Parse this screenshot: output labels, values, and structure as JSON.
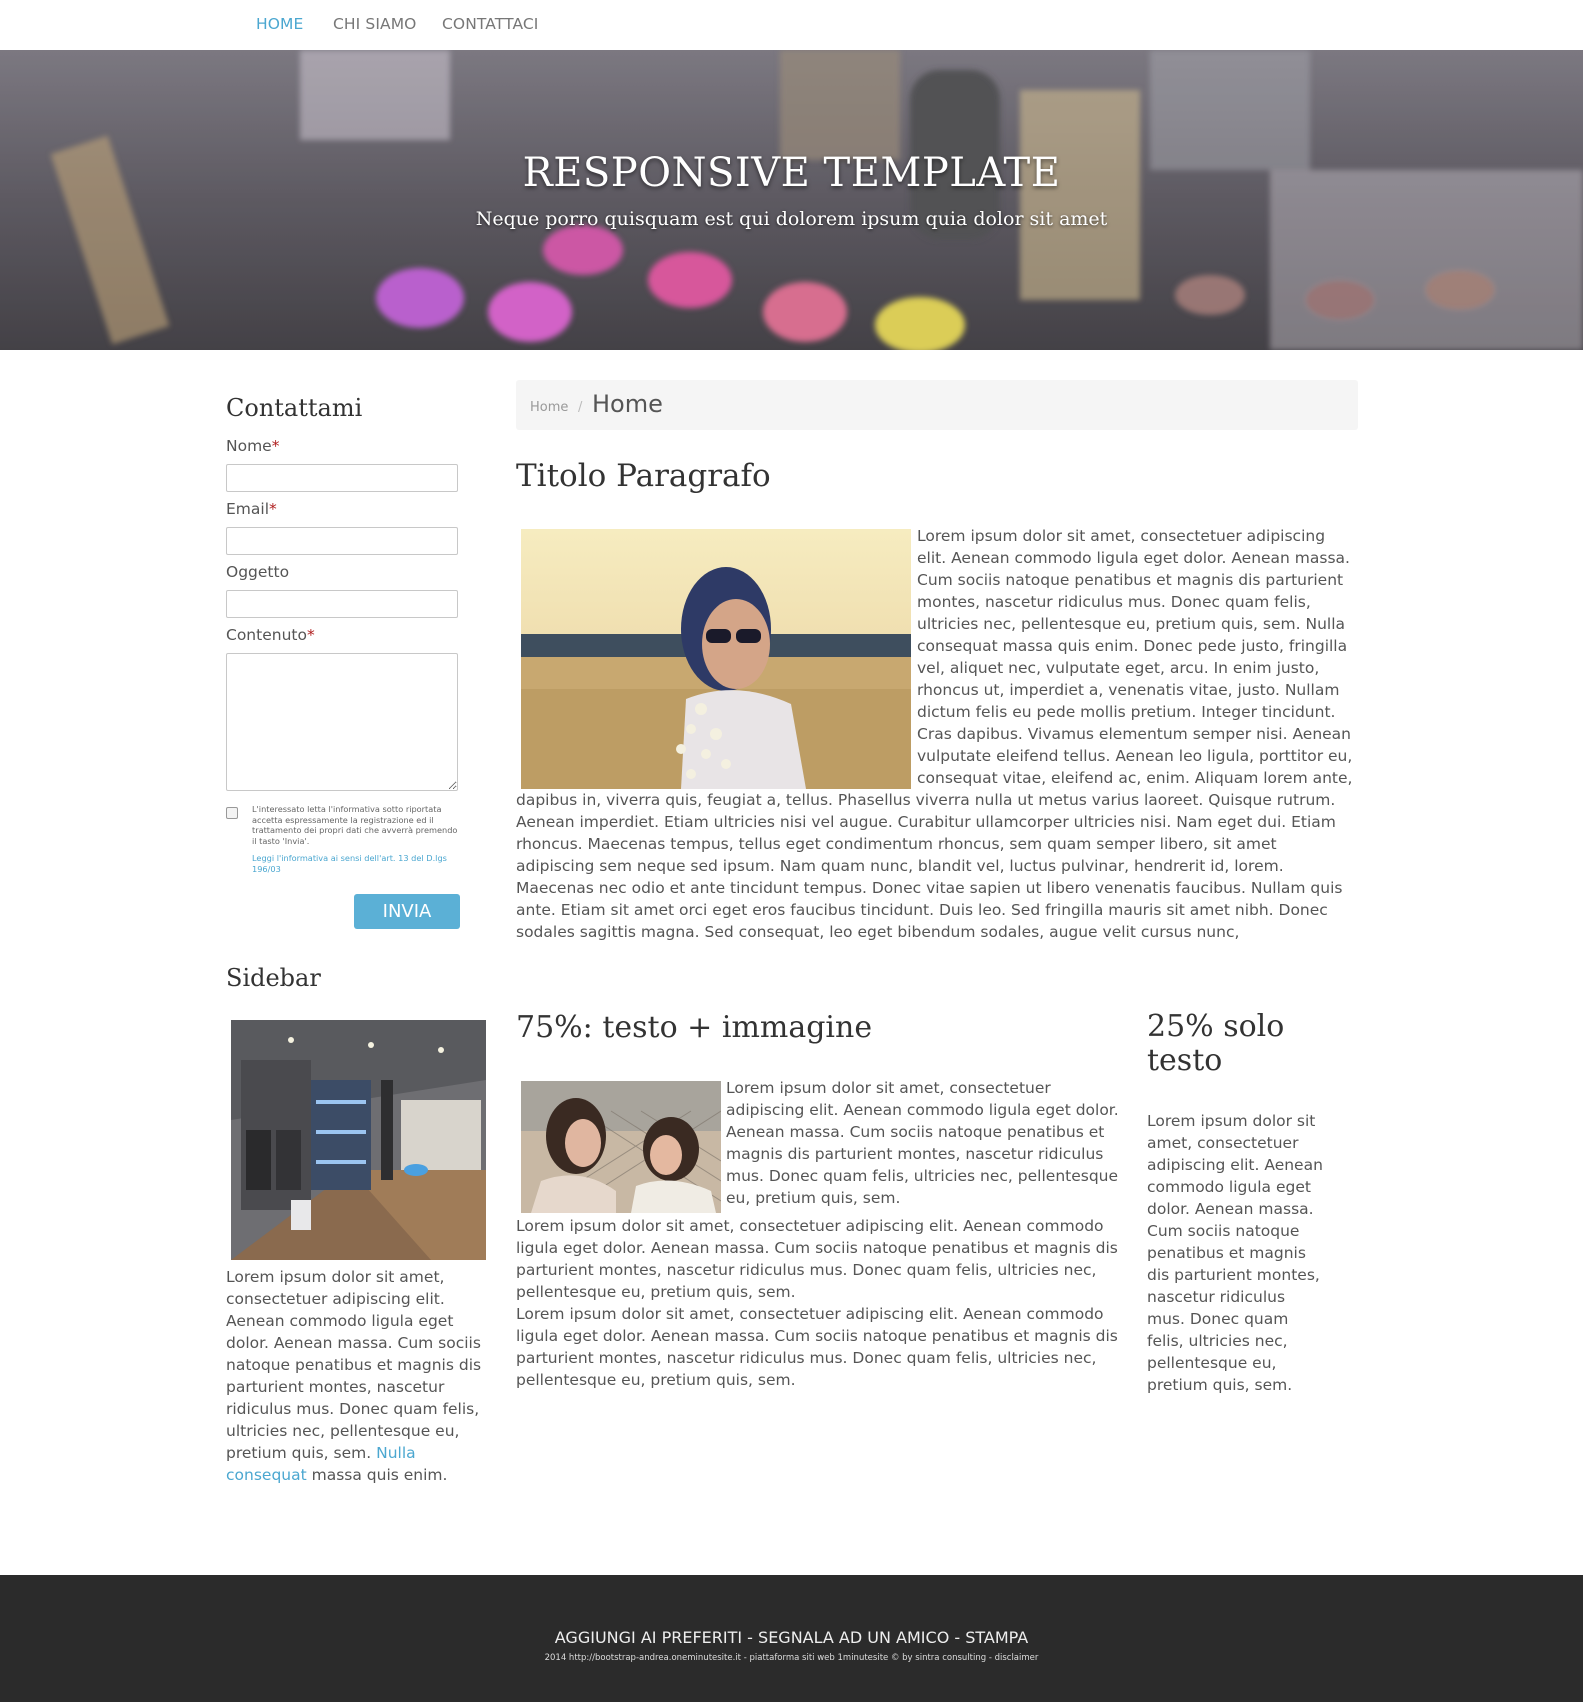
{
  "nav": {
    "items": [
      {
        "label": "HOME",
        "active": true
      },
      {
        "label": "CHI SIAMO",
        "active": false
      },
      {
        "label": "CONTATTACI",
        "active": false
      }
    ]
  },
  "hero": {
    "title": "RESPONSIVE TEMPLATE",
    "subtitle": "Neque porro quisquam est qui dolorem ipsum quia dolor sit amet"
  },
  "contact_form": {
    "heading": "Contattami",
    "fields": {
      "nome": {
        "label": "Nome",
        "required": "*",
        "value": ""
      },
      "email": {
        "label": "Email",
        "required": "*",
        "value": ""
      },
      "oggetto": {
        "label": "Oggetto",
        "value": ""
      },
      "contenuto": {
        "label": "Contenuto",
        "required": "*",
        "value": ""
      }
    },
    "consent_text": "L'interessato letta l'informativa sotto riportata accetta espressamente la registrazione ed il trattamento dei propri dati che avverrà premendo il tasto 'Invia'.",
    "consent_link": "Leggi l'informativa ai sensi dell'art. 13 del D.lgs 196/03",
    "submit_label": "INVIA"
  },
  "sidebar": {
    "heading": "Sidebar",
    "text_before_link": "Lorem ipsum dolor sit amet, consectetuer adipiscing elit. Aenean commodo ligula eget dolor. Aenean massa. Cum sociis natoque penatibus et magnis dis parturient montes, nascetur ridiculus mus. Donec quam felis, ultricies nec, pellentesque eu, pretium quis, sem.",
    "link_text": "Nulla consequat",
    "text_after_link": "massa quis enim."
  },
  "breadcrumb": {
    "home": "Home",
    "separator": "/",
    "current": "Home"
  },
  "main": {
    "heading": "Titolo Paragrafo",
    "body": "Lorem ipsum dolor sit amet, consectetuer adipiscing elit. Aenean commodo ligula eget dolor. Aenean massa. Cum sociis natoque penatibus et magnis dis parturient montes, nascetur ridiculus mus. Donec quam felis, ultricies nec, pellentesque eu, pretium quis, sem. Nulla consequat massa quis enim. Donec pede justo, fringilla vel, aliquet nec, vulputate eget, arcu. In enim justo, rhoncus ut, imperdiet a, venenatis vitae, justo. Nullam dictum felis eu pede mollis pretium. Integer tincidunt. Cras dapibus. Vivamus elementum semper nisi. Aenean vulputate eleifend tellus. Aenean leo ligula, porttitor eu, consequat vitae, eleifend ac, enim. Aliquam lorem ante, dapibus in, viverra quis, feugiat a, tellus. Phasellus viverra nulla ut metus varius laoreet. Quisque rutrum. Aenean imperdiet. Etiam ultricies nisi vel augue. Curabitur ullamcorper ultricies nisi. Nam eget dui. Etiam rhoncus. Maecenas tempus, tellus eget condimentum rhoncus, sem quam semper libero, sit amet adipiscing sem neque sed ipsum. Nam quam nunc, blandit vel, luctus pulvinar, hendrerit id, lorem. Maecenas nec odio et ante tincidunt tempus. Donec vitae sapien ut libero venenatis faucibus. Nullam quis ante. Etiam sit amet orci eget eros faucibus tincidunt. Duis leo. Sed fringilla mauris sit amet nibh. Donec sodales sagittis magna. Sed consequat, leo eget bibendum sodales, augue velit cursus nunc,"
  },
  "section_75": {
    "heading": "75%: testo + immagine",
    "para1": "Lorem ipsum dolor sit amet, consectetuer adipiscing elit. Aenean commodo ligula eget dolor. Aenean massa. Cum sociis natoque penatibus et magnis dis parturient montes, nascetur ridiculus mus. Donec quam felis, ultricies nec, pellentesque eu, pretium quis, sem.",
    "para2": "Lorem ipsum dolor sit amet, consectetuer adipiscing elit. Aenean commodo ligula eget dolor. Aenean massa. Cum sociis natoque penatibus et magnis dis parturient montes, nascetur ridiculus mus. Donec quam felis, ultricies nec, pellentesque eu, pretium quis, sem.",
    "para3": "Lorem ipsum dolor sit amet, consectetuer adipiscing elit. Aenean commodo ligula eget dolor. Aenean massa. Cum sociis natoque penatibus et magnis dis parturient montes, nascetur ridiculus mus. Donec quam felis, ultricies nec, pellentesque eu, pretium quis, sem."
  },
  "section_25": {
    "heading": "25% solo testo",
    "body": "Lorem ipsum dolor sit amet, consectetuer adipiscing elit. Aenean commodo ligula eget dolor. Aenean massa. Cum sociis natoque penatibus et magnis dis parturient montes, nascetur ridiculus mus. Donec quam felis, ultricies nec, pellentesque eu, pretium quis, sem."
  },
  "footer": {
    "links": "AGGIUNGI AI PREFERITI - SEGNALA AD UN AMICO - STAMPA",
    "credits": "2014 http://bootstrap-andrea.oneminutesite.it - piattaforma siti web 1minutesite © by sintra consulting - disclaimer"
  },
  "colors": {
    "accent": "#4ba7d0",
    "button": "#5bb0d6",
    "footer_bg": "#2b2b2b",
    "required": "#b02020"
  }
}
